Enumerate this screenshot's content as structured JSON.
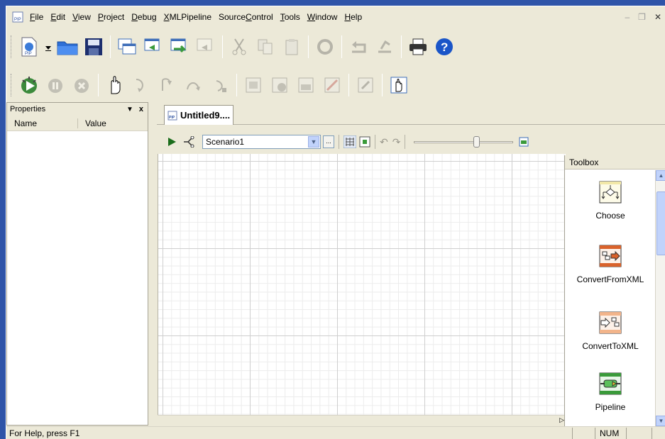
{
  "menubar": {
    "items": [
      "File",
      "Edit",
      "View",
      "Project",
      "Debug",
      "XMLPipeline",
      "SourceControl",
      "Tools",
      "Window",
      "Help"
    ],
    "underline": [
      "F",
      "E",
      "V",
      "P",
      "D",
      "X",
      "C",
      "T",
      "W",
      "H"
    ],
    "window_controls": [
      "_",
      "̅❐",
      "x"
    ]
  },
  "toolbar1": {
    "icons": [
      "new-project-icon",
      "dropdown-arrow-icon",
      "open-folder-icon",
      "save-icon",
      "window-icon",
      "window-back-icon",
      "window-forward-icon",
      "window-disabled-icon",
      "cut-icon",
      "copy-icon",
      "paste-icon",
      "refresh-icon",
      "undo-icon",
      "redo-icon",
      "print-icon",
      "help-icon"
    ]
  },
  "toolbar2": {
    "icons": [
      "debug-run-icon",
      "debug-pause-icon",
      "debug-stop-icon",
      "hand-pointer-icon",
      "step-into-icon",
      "step-over-icon",
      "step-out-icon",
      "run-to-cursor-icon",
      "breakpoint-window-icon",
      "watch-window-icon",
      "locals-window-icon",
      "clear-breakpoints-icon",
      "trace-icon",
      "hand-select-icon"
    ]
  },
  "properties": {
    "title": "Properties",
    "pin": "•",
    "close": "x",
    "columns": [
      "Name",
      "Value"
    ]
  },
  "document": {
    "tab_label": "Untitled9....",
    "scenario": "Scenario1"
  },
  "toolbox": {
    "title": "Toolbox",
    "items": [
      "Choose",
      "ConvertFromXML",
      "ConvertToXML",
      "Pipeline"
    ]
  },
  "statusbar": {
    "help": "For Help, press F1",
    "num": "NUM"
  },
  "colors": {
    "frame_blue": "#2f54a8",
    "chrome": "#ece9d8",
    "accent_orange": "#d9622b",
    "accent_green": "#3a9a3a"
  }
}
